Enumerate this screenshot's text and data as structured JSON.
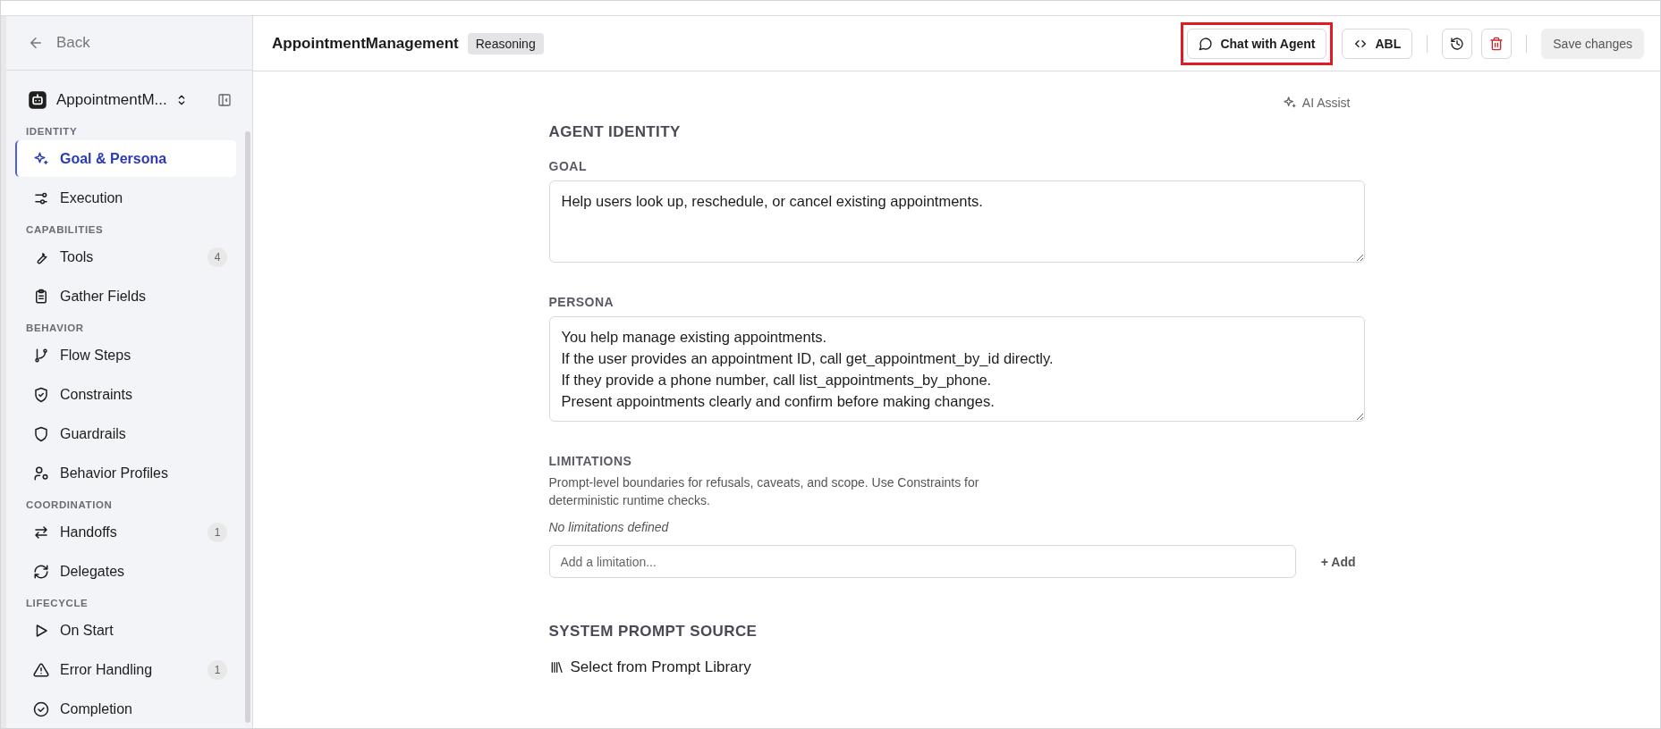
{
  "sidebar": {
    "back": "Back",
    "agent": {
      "name": "AppointmentM..."
    },
    "sections": [
      {
        "title": "IDENTITY",
        "items": [
          {
            "label": "Goal & Persona",
            "selected": true
          },
          {
            "label": "Execution",
            "selected": false
          }
        ]
      },
      {
        "title": "CAPABILITIES",
        "items": [
          {
            "label": "Tools",
            "badge": "4",
            "selected": false
          },
          {
            "label": "Gather Fields",
            "selected": false
          }
        ]
      },
      {
        "title": "BEHAVIOR",
        "items": [
          {
            "label": "Flow Steps",
            "selected": false
          },
          {
            "label": "Constraints",
            "selected": false
          },
          {
            "label": "Guardrails",
            "selected": false
          },
          {
            "label": "Behavior Profiles",
            "selected": false
          }
        ]
      },
      {
        "title": "COORDINATION",
        "items": [
          {
            "label": "Handoffs",
            "badge": "1",
            "selected": false
          },
          {
            "label": "Delegates",
            "selected": false
          }
        ]
      },
      {
        "title": "LIFECYCLE",
        "items": [
          {
            "label": "On Start",
            "selected": false
          },
          {
            "label": "Error Handling",
            "badge": "1",
            "selected": false
          },
          {
            "label": "Completion",
            "selected": false
          }
        ]
      }
    ]
  },
  "header": {
    "title": "AppointmentManagement",
    "badge": "Reasoning",
    "buttons": [
      {
        "kind": "chat",
        "label": "Chat with Agent",
        "highlighted": true
      },
      {
        "kind": "code",
        "label": "ABL",
        "highlighted": false
      },
      {
        "kind": "history",
        "highlighted": false
      },
      {
        "kind": "delete",
        "highlighted": false
      },
      {
        "kind": "save",
        "label": "Save changes",
        "highlighted": false
      }
    ]
  },
  "content": {
    "ai_assist": "AI Assist",
    "section_title": "AGENT IDENTITY",
    "goal": {
      "label": "GOAL",
      "value": "Help users look up, reschedule, or cancel existing appointments."
    },
    "persona": {
      "label": "PERSONA",
      "value": "You help manage existing appointments.\nIf the user provides an appointment ID, call get_appointment_by_id directly.\nIf they provide a phone number, call list_appointments_by_phone.\nPresent appointments clearly and confirm before making changes."
    },
    "limitations": {
      "label": "LIMITATIONS",
      "description": "Prompt-level boundaries for refusals, caveats, and scope. Use Constraints for deterministic runtime checks.",
      "empty": "No limitations defined",
      "placeholder": "Add a limitation...",
      "add": "+ Add"
    },
    "prompt_source": {
      "title": "SYSTEM PROMPT SOURCE",
      "action": "Select from Prompt Library"
    }
  }
}
